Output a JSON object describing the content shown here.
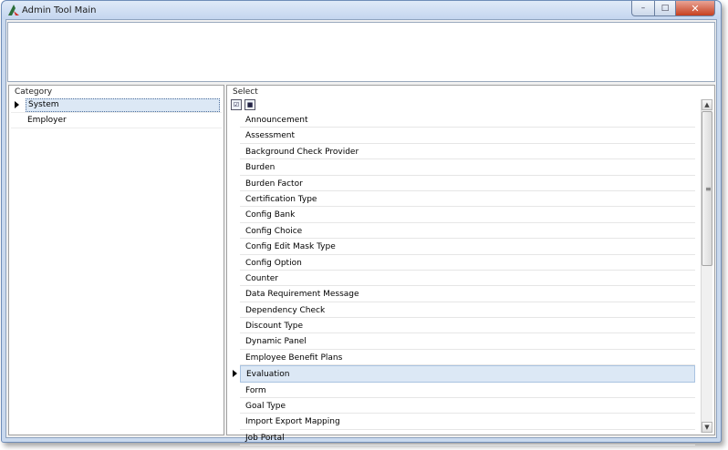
{
  "window": {
    "title": "Admin Tool Main"
  },
  "category": {
    "label": "Category",
    "items": [
      "System",
      "Employer"
    ]
  },
  "select": {
    "label": "Select",
    "items": [
      "Announcement",
      "Assessment",
      "Background Check Provider",
      "Burden",
      "Burden Factor",
      "Certification Type",
      "Config Bank",
      "Config Choice",
      "Config Edit Mask Type",
      "Config Option",
      "Counter",
      "Data Requirement Message",
      "Dependency Check",
      "Discount Type",
      "Dynamic Panel",
      "Employee Benefit Plans",
      "Evaluation",
      "Form",
      "Goal Type",
      "Import Export Mapping",
      "Job Portal"
    ]
  }
}
